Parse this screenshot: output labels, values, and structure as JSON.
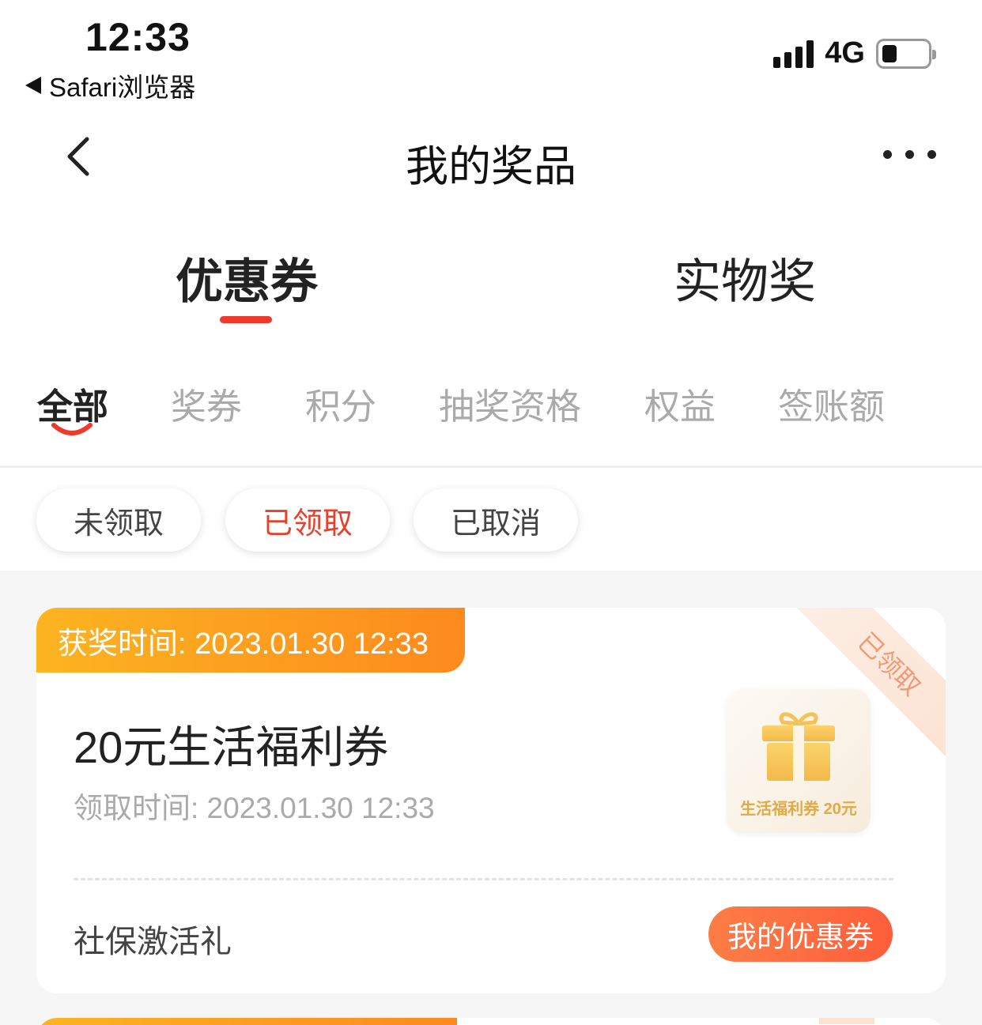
{
  "status_bar": {
    "time": "12:33",
    "back_app": "Safari浏览器",
    "network": "4G"
  },
  "nav": {
    "title": "我的奖品"
  },
  "main_tabs": [
    {
      "label": "优惠券",
      "active": true
    },
    {
      "label": "实物奖",
      "active": false
    }
  ],
  "sub_tabs": [
    {
      "label": "全部",
      "active": true
    },
    {
      "label": "奖券",
      "active": false
    },
    {
      "label": "积分",
      "active": false
    },
    {
      "label": "抽奖资格",
      "active": false
    },
    {
      "label": "权益",
      "active": false
    },
    {
      "label": "签账额",
      "active": false
    }
  ],
  "filters": [
    {
      "label": "未领取",
      "active": false
    },
    {
      "label": "已领取",
      "active": true
    },
    {
      "label": "已取消",
      "active": false
    }
  ],
  "prize_card": {
    "award_time": "获奖时间: 2023.01.30 12:33",
    "status_ribbon": "已领取",
    "title": "20元生活福利券",
    "claim_time": "领取时间: 2023.01.30 12:33",
    "thumb_label": "生活福利券 20元",
    "source": "社保激活礼",
    "action_label": "我的优惠券"
  },
  "colors": {
    "accent_red": "#f0392b",
    "header_gradient_start": "#fcb421",
    "header_gradient_end": "#fd8a1e",
    "button_gradient_start": "#fd7d45",
    "button_gradient_end": "#fd5e3b"
  },
  "icons": {
    "nav_back": "chevron-left-icon",
    "nav_more": "more-icon",
    "thumb": "gift-icon"
  }
}
